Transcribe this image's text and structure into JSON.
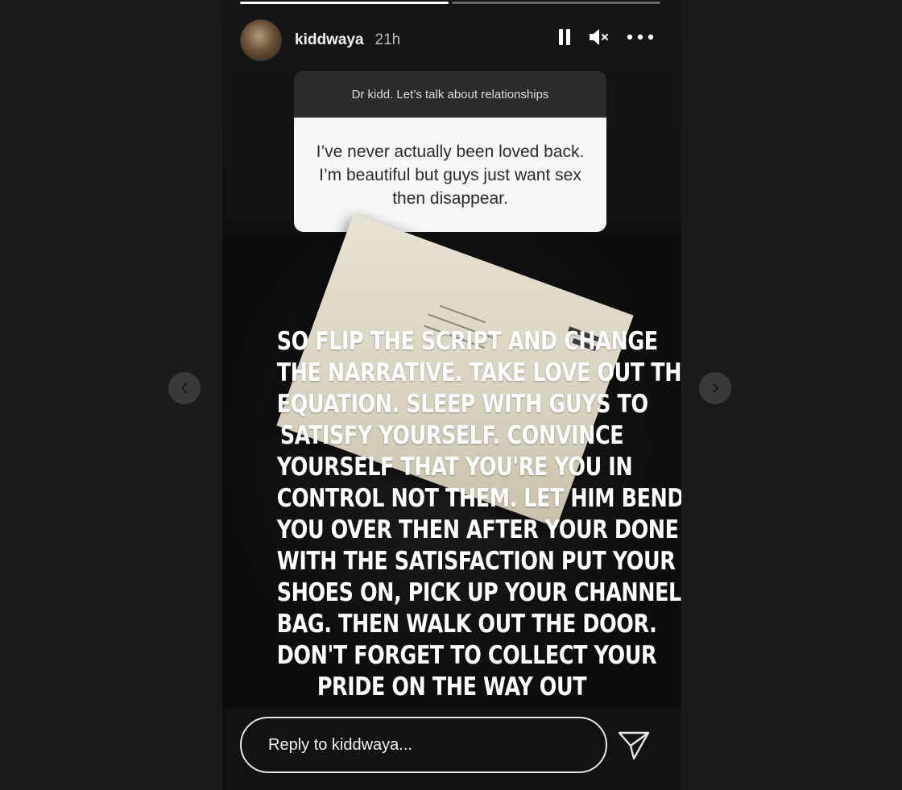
{
  "story": {
    "progress": [
      1,
      0
    ],
    "user": {
      "username": "kiddwaya",
      "posted_ago": "21h"
    },
    "controls": {
      "pause_icon": "pause-icon",
      "mute_icon": "volume-muted-icon",
      "more_icon": "more-horizontal-icon"
    },
    "question": {
      "prompt": "Dr kidd. Let’s talk about relationships",
      "answer": "I’ve never actually been loved back. I’m beautiful but guys just want sex then disappear."
    },
    "caption_lines": [
      "SO FLIP THE SCRIPT AND CHANGE",
      "THE NARRATIVE. TAKE LOVE OUT THE",
      "EQUATION. SLEEP WITH GUYS TO",
      "SATISFY YOURSELF. CONVINCE",
      "YOURSELF THAT YOU'RE YOU IN",
      "CONTROL NOT THEM. LET HIM BEND",
      "YOU OVER THEN AFTER YOUR DONE",
      "WITH THE SATISFACTION PUT YOUR",
      "SHOES ON, PICK UP YOUR CHANNEL",
      "BAG. THEN WALK OUT THE DOOR.",
      "DON'T FORGET TO COLLECT YOUR",
      "PRIDE ON THE WAY OUT"
    ],
    "reply": {
      "placeholder": "Reply to kiddwaya..."
    }
  },
  "navigation": {
    "prev_icon": "chevron-left-icon",
    "next_icon": "chevron-right-icon"
  },
  "colors": {
    "page_background": "#1b1b1b",
    "story_background": "#121212",
    "question_header": "#2b2b2b",
    "question_body": "#f7f7f7"
  }
}
